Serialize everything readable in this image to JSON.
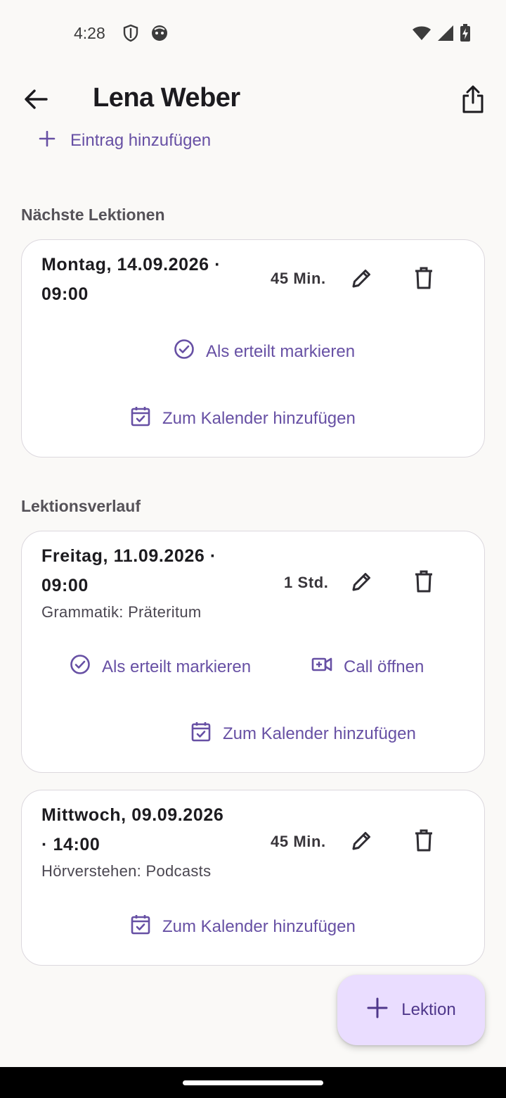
{
  "status_bar": {
    "time": "4:28",
    "left_icons": [
      "shield-icon",
      "robot-face-icon"
    ],
    "right_icons": [
      "wifi-icon",
      "cellular-signal-icon",
      "battery-charging-icon"
    ]
  },
  "top_bar": {
    "title": "Lena Weber",
    "back_icon": "arrow-back-icon",
    "share_icon": "share-icon"
  },
  "add_entry": {
    "label": "Eintrag hinzufügen"
  },
  "upcoming": {
    "section_title": "Nächste Lektionen",
    "lessons": [
      {
        "date_line1": "Montag, 14.09.2026 ·",
        "date_line2": "09:00",
        "duration": "45 Min.",
        "mark_label": "Als erteilt markieren",
        "calendar_label": "Zum Kalender hinzufügen"
      }
    ]
  },
  "history": {
    "section_title": "Lektionsverlauf",
    "lessons": [
      {
        "date_line1": "Freitag, 11.09.2026 ·",
        "date_line2": "09:00",
        "duration": "1 Std.",
        "topic": "Grammatik: Präteritum",
        "mark_label": "Als erteilt markieren",
        "call_label": "Call öffnen",
        "calendar_label": "Zum Kalender hinzufügen"
      },
      {
        "date_line1": "Mittwoch, 09.09.2026",
        "date_line2": "· 14:00",
        "duration": "45 Min.",
        "topic": "Hörverstehen: Podcasts",
        "calendar_label": "Zum Kalender hinzufügen"
      }
    ]
  },
  "fab": {
    "label": "Lektion"
  },
  "colors": {
    "accent": "#6750A4",
    "fab_background": "#EADDFF",
    "background": "#FAF9F7",
    "card_border": "#DCD8DE"
  }
}
